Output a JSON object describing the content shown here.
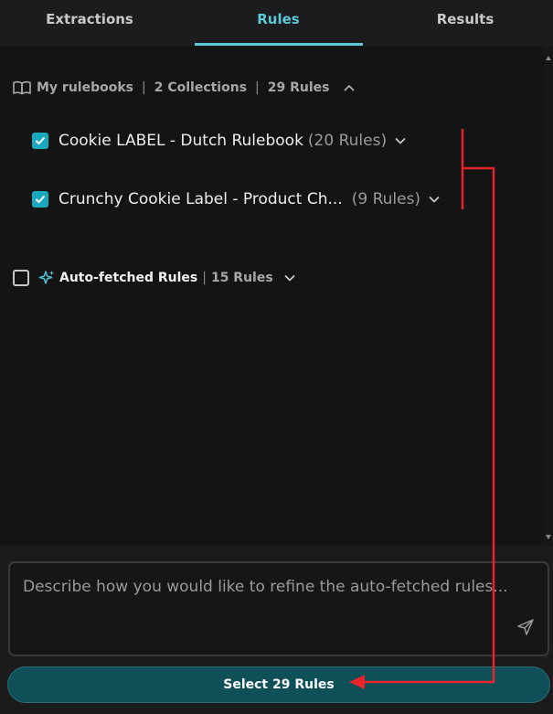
{
  "tabs": [
    {
      "label": "Extractions",
      "active": false
    },
    {
      "label": "Rules",
      "active": true
    },
    {
      "label": "Results",
      "active": false
    }
  ],
  "rulebooks_header": {
    "icon": "book-icon",
    "title": "My rulebooks",
    "collections": "2 Collections",
    "rules": "29 Rules",
    "expanded": true
  },
  "rulebooks": [
    {
      "name": "Cookie LABEL - Dutch Rulebook",
      "count": "(20 Rules)",
      "checked": true
    },
    {
      "name": "Crunchy Cookie Label - Product Ch...",
      "count": "(9 Rules)",
      "checked": true
    }
  ],
  "auto_fetched": {
    "icon": "sparkle-icon",
    "label": "Auto-fetched Rules",
    "count": "15 Rules",
    "checked": false
  },
  "refine": {
    "placeholder": "Describe how you would like to refine the auto-fetched rules...",
    "value": ""
  },
  "select_button": {
    "label": "Select 29 Rules"
  },
  "colors": {
    "accent": "#5fc8d6",
    "checkbox": "#19a9bf",
    "button_bg": "#0e4f58",
    "annotation": "#e8242b"
  }
}
